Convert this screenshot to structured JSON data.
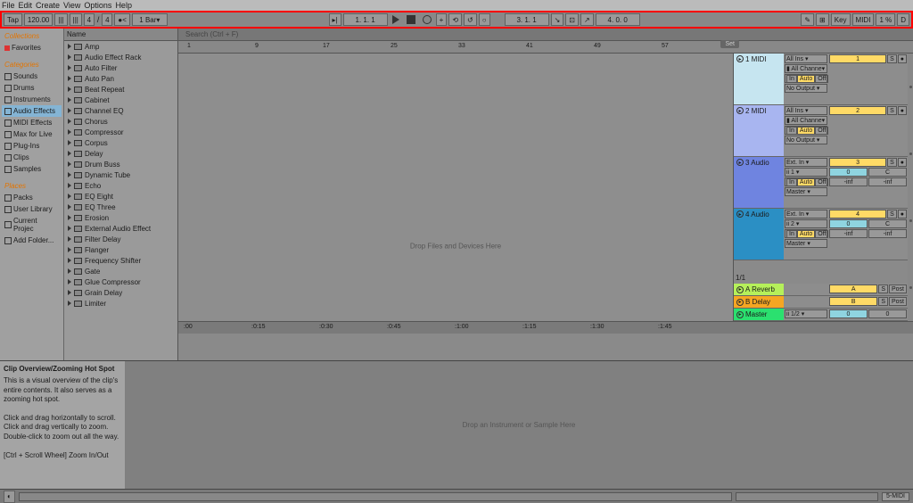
{
  "menu": [
    "File",
    "Edit",
    "Create",
    "View",
    "Options",
    "Help"
  ],
  "toolbar": {
    "tap": "Tap",
    "bpm": "120.00",
    "sig_a": "4",
    "sig_b": "4",
    "metron": "1 Bar",
    "pos": "1. 1. 1",
    "pos2": "3. 1. 1",
    "loop": "4. 0. 0",
    "key": "Key",
    "midi": "MIDI",
    "pct": "1 %",
    "d": "D"
  },
  "search_placeholder": "Search (Ctrl + F)",
  "browser": {
    "collections": "Collections",
    "favorites": "Favorites",
    "categories": "Categories",
    "cat_items": [
      "Sounds",
      "Drums",
      "Instruments",
      "Audio Effects",
      "MIDI Effects",
      "Max for Live",
      "Plug-Ins",
      "Clips",
      "Samples"
    ],
    "cat_sel": 3,
    "places": "Places",
    "place_items": [
      "Packs",
      "User Library",
      "Current Projec",
      "Add Folder..."
    ]
  },
  "name_header": "Name",
  "devices": [
    "Amp",
    "Audio Effect Rack",
    "Auto Filter",
    "Auto Pan",
    "Beat Repeat",
    "Cabinet",
    "Channel EQ",
    "Chorus",
    "Compressor",
    "Corpus",
    "Delay",
    "Drum Buss",
    "Dynamic Tube",
    "Echo",
    "EQ Eight",
    "EQ Three",
    "Erosion",
    "External Audio Effect",
    "Filter Delay",
    "Flanger",
    "Frequency Shifter",
    "Gate",
    "Glue Compressor",
    "Grain Delay",
    "Limiter"
  ],
  "ruler_bars": [
    "1",
    "9",
    "17",
    "25",
    "33",
    "41",
    "49",
    "57"
  ],
  "set": "Set",
  "drop_files": "Drop Files and Devices Here",
  "drop_device": "Drop an Instrument or Sample Here",
  "io": {
    "allins": "All Ins",
    "allch": "All Channe",
    "in": "In",
    "auto": "Auto",
    "off": "Off",
    "noout": "No Output",
    "ext": "Ext. In",
    "master": "Master",
    "half": "ii 1/2",
    "i1": "ii 1",
    "i2": "ii 2",
    "post": "Post",
    "ninf": "-inf"
  },
  "tracks": [
    {
      "name": "1 MIDI",
      "cls": "c1",
      "num": "1"
    },
    {
      "name": "2 MIDI",
      "cls": "c2",
      "num": "2"
    },
    {
      "name": "3 Audio",
      "cls": "c3",
      "num": "3"
    },
    {
      "name": "4 Audio",
      "cls": "c4",
      "num": "4"
    }
  ],
  "returns": [
    {
      "name": "A Reverb",
      "cls": "cr1",
      "num": "A"
    },
    {
      "name": "B Delay",
      "cls": "cr2",
      "num": "B"
    }
  ],
  "master": {
    "name": "Master",
    "cls": "cm",
    "num": "0"
  },
  "one_one": "1/1",
  "labels": {
    "s": "S",
    "c": "C",
    "zero": "0"
  },
  "time_marks": [
    ":00",
    ":0:15",
    ":0:30",
    ":0:45",
    ":1:00",
    ":1:15",
    ":1:30",
    ":1:45"
  ],
  "info": {
    "title": "Clip Overview/Zooming Hot Spot",
    "p1": "This is a visual overview of the clip's entire contents. It also serves as a zooming hot spot.",
    "p2": "Click and drag horizontally to scroll. Click and drag vertically to zoom. Double-click to zoom out all the way.",
    "p3": "[Ctrl + Scroll Wheel] Zoom In/Out"
  },
  "status_midi": "5-MIDI"
}
